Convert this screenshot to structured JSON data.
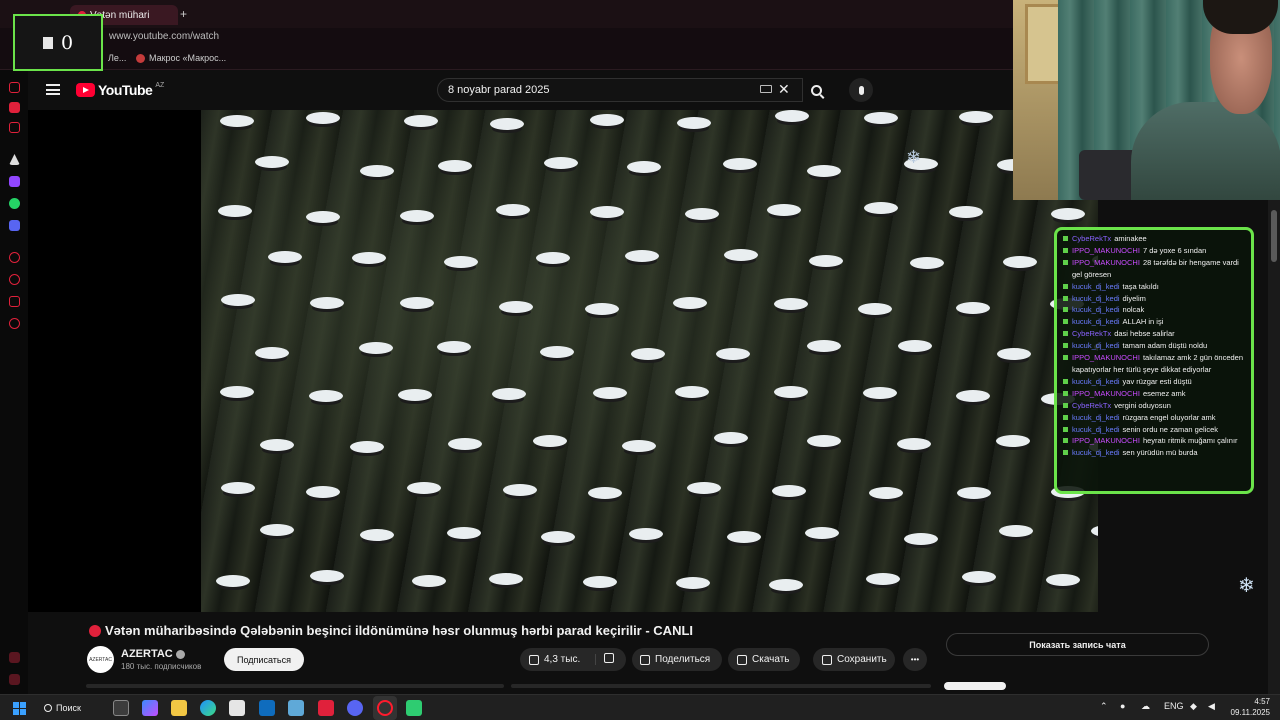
{
  "browser": {
    "active_tab_title": "Vətən mühari",
    "url": "www.youtube.com/watch",
    "bookmarks": [
      "Ле...",
      "Макрос «Макрос..."
    ]
  },
  "overlay_counter": {
    "value": "0"
  },
  "youtube": {
    "logo_text": "YouTube",
    "logo_region": "AZ",
    "search_query": "8 noyabr parad 2025",
    "video_title": "Vətən müharibəsində Qələbənin beşinci ildönümünə həsr olunmuş hərbi parad keçirilir - CANLI",
    "channel": {
      "name": "AZERTAC",
      "avatar_text": "AZERTAC",
      "subscribers": "180 тыс. подписчиков",
      "subscribe_label": "Подписаться"
    },
    "actions": {
      "likes": "4,3 тыс.",
      "share_label": "Поделиться",
      "download_label": "Скачать",
      "save_label": "Сохранить",
      "more_label": "•••"
    },
    "chat_replay_label": "Показать запись чата",
    "video_watermark": "❄"
  },
  "chat": {
    "accent_color": "#6be34a",
    "messages": [
      {
        "user": "CybeRekTx",
        "color": "#8a63ff",
        "text": "aminakee"
      },
      {
        "user": "IPPO_MAKUNOCHI",
        "color": "#c94cff",
        "text": "7 də yoxe 6 sından"
      },
      {
        "user": "IPPO_MAKUNOCHI",
        "color": "#c94cff",
        "text": "28 tərəfdə bir hengame vardi gel göresen"
      },
      {
        "user": "kucuk_dj_kedi",
        "color": "#6b7cff",
        "text": "taşa takıldı"
      },
      {
        "user": "kucuk_dj_kedi",
        "color": "#6b7cff",
        "text": "diyelim"
      },
      {
        "user": "kucuk_dj_kedi",
        "color": "#6b7cff",
        "text": "nolcak"
      },
      {
        "user": "kucuk_dj_kedi",
        "color": "#6b7cff",
        "text": "ALLAH in işi"
      },
      {
        "user": "CybeRekTx",
        "color": "#8a63ff",
        "text": "dasi hebse salirlar"
      },
      {
        "user": "kucuk_dj_kedi",
        "color": "#6b7cff",
        "text": "tamam adam düştü noldu"
      },
      {
        "user": "IPPO_MAKUNOCHI",
        "color": "#c94cff",
        "text": "takılamaz amk 2 gün önceden kapatıyorlar her türlü şeye dikkat ediyorlar"
      },
      {
        "user": "kucuk_dj_kedi",
        "color": "#6b7cff",
        "text": "yav rüzgar esti düştü"
      },
      {
        "user": "IPPO_MAKUNOCHI",
        "color": "#c94cff",
        "text": "esemez amk"
      },
      {
        "user": "CybeRekTx",
        "color": "#8a63ff",
        "text": "vergini oduyosun"
      },
      {
        "user": "kucuk_dj_kedi",
        "color": "#6b7cff",
        "text": "rüzgara engel oluyorlar amk"
      },
      {
        "user": "kucuk_dj_kedi",
        "color": "#6b7cff",
        "text": "senin ordu ne zaman gelicek"
      },
      {
        "user": "IPPO_MAKUNOCHI",
        "color": "#c94cff",
        "text": "heyratı ritmik muğamı çalınır"
      },
      {
        "user": "kucuk_dj_kedi",
        "color": "#6b7cff",
        "text": "sen yürüdün mü burda"
      }
    ]
  },
  "taskbar": {
    "search_label": "Поиск",
    "language": "ENG",
    "time": "4:57",
    "date": "09.11.2025"
  }
}
